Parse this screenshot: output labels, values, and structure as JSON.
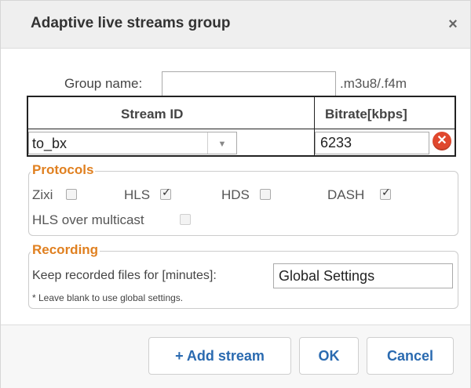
{
  "dialog": {
    "title": "Adaptive live streams group",
    "close_glyph": "×"
  },
  "group": {
    "label": "Group name:",
    "value": "",
    "suffix": ".m3u8/.f4m"
  },
  "stream_table": {
    "columns": [
      "Stream ID",
      "Bitrate[kbps]"
    ],
    "rows": [
      {
        "stream_id": "to_bx",
        "bitrate": "6233"
      }
    ],
    "caret": "▼",
    "remove_glyph": "✕"
  },
  "protocols": {
    "legend": "Protocols",
    "options": [
      {
        "label": "Zixi",
        "checked": false,
        "disabled": false
      },
      {
        "label": "HLS",
        "checked": true,
        "disabled": false
      },
      {
        "label": "HDS",
        "checked": false,
        "disabled": false
      },
      {
        "label": "DASH",
        "checked": true,
        "disabled": false
      },
      {
        "label": "HLS over multicast",
        "checked": false,
        "disabled": true
      }
    ]
  },
  "recording": {
    "legend": "Recording",
    "keep_label": "Keep recorded files for [minutes]:",
    "keep_value": "Global Settings",
    "note": "* Leave blank to use global settings."
  },
  "footer": {
    "add_stream": "+ Add stream",
    "ok": "OK",
    "cancel": "Cancel"
  },
  "colors": {
    "legend": "#e08020",
    "button_text": "#2a6ab0",
    "remove": "#e0482e"
  }
}
